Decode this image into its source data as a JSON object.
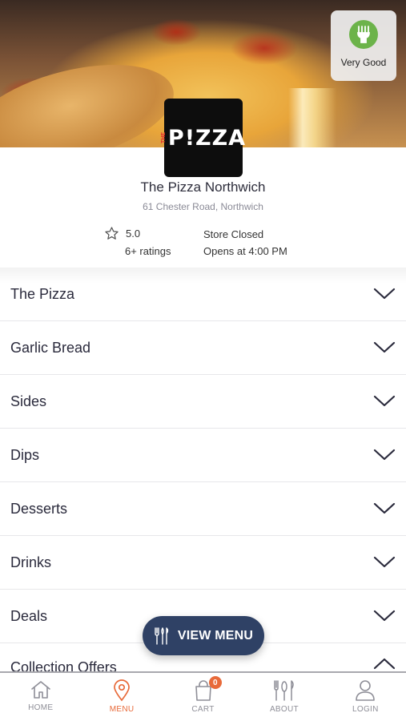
{
  "hygiene": {
    "rating_label": "Very Good"
  },
  "store": {
    "logo_text": "P!ZZA",
    "logo_prefix": "THE",
    "name": "The Pizza Northwich",
    "address": "61 Chester Road, Northwich",
    "rating": "5.0",
    "rating_count": "6+ ratings",
    "status": "Store Closed",
    "opens": "Opens at 4:00 PM"
  },
  "categories": [
    {
      "label": "The Pizza",
      "expanded": false
    },
    {
      "label": "Garlic Bread",
      "expanded": false
    },
    {
      "label": "Sides",
      "expanded": false
    },
    {
      "label": "Dips",
      "expanded": false
    },
    {
      "label": "Desserts",
      "expanded": false
    },
    {
      "label": "Drinks",
      "expanded": false
    },
    {
      "label": "Deals",
      "expanded": false
    },
    {
      "label": "Collection Offers",
      "expanded": true
    }
  ],
  "view_menu": {
    "label": "VIEW MENU",
    "icon": "cutlery-icon"
  },
  "nav": {
    "items": [
      {
        "label": "HOME",
        "icon": "home-icon"
      },
      {
        "label": "MENU",
        "icon": "location-pin-icon",
        "active": true
      },
      {
        "label": "CART",
        "icon": "cart-icon",
        "badge": "0"
      },
      {
        "label": "ABOUT",
        "icon": "cutlery-icon"
      },
      {
        "label": "LOGIN",
        "icon": "user-icon"
      }
    ]
  },
  "colors": {
    "accent": "#e86a3a",
    "button_bg": "#2f4165",
    "hygiene_green": "#6cb34a",
    "logo_red": "#e3262e"
  }
}
